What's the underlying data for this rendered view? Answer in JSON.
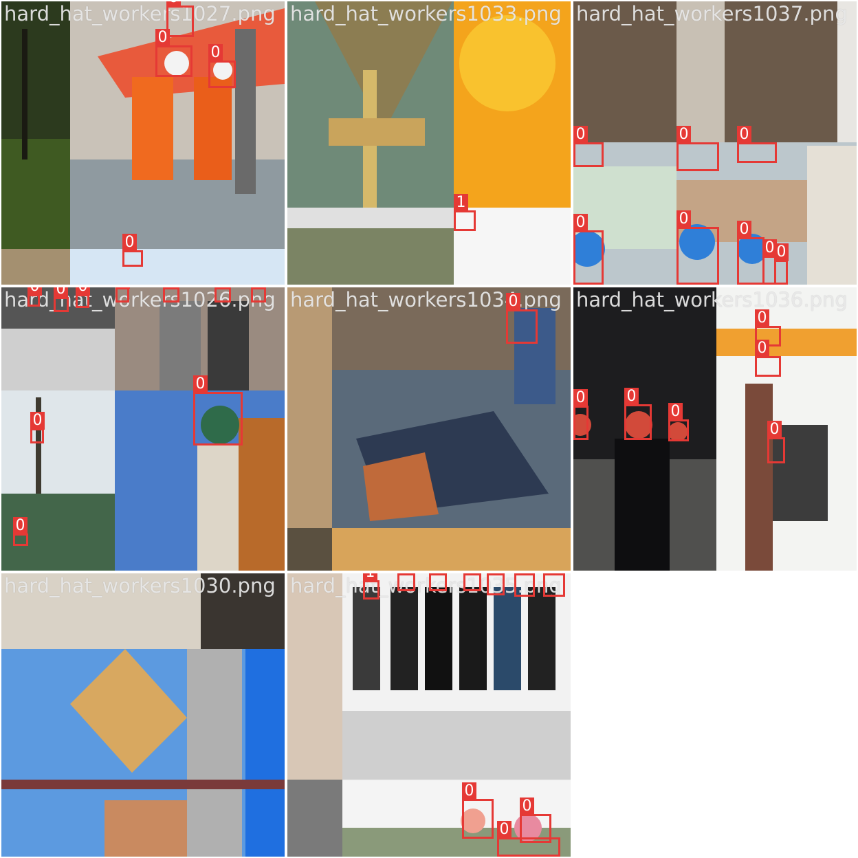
{
  "box_color": "#e53935",
  "tiles": [
    {
      "filename": "hard_hat_workers1027.png"
    },
    {
      "filename": "hard_hat_workers1033.png"
    },
    {
      "filename": "hard_hat_workers1037.png"
    },
    {
      "filename": "hard_hat_workers1026.png"
    },
    {
      "filename": "hard_hat_workers1034.png"
    },
    {
      "filename": "hard_hat_workers1036.png"
    },
    {
      "filename": "hard_hat_workers1030.png"
    },
    {
      "filename": "hard_hat_workers1035.png"
    }
  ],
  "labels": {
    "helmet": "0",
    "head": "1"
  }
}
